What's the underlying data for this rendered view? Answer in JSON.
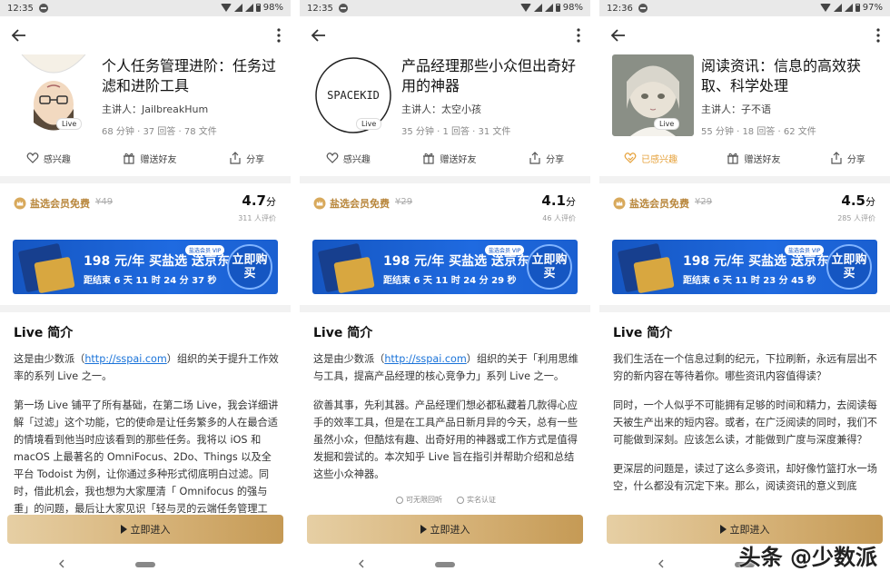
{
  "screens": [
    {
      "status": {
        "time": "12:35",
        "battery": "98%"
      },
      "title": "个人任务管理进阶：任务过滤和进阶工具",
      "speaker": "主讲人：JailbreakHum",
      "meta": "68 分钟 · 37 回答 · 78 文件",
      "live_tag": "Live",
      "actions": {
        "interest": "感兴趣",
        "gift": "赠送好友",
        "share": "分享"
      },
      "vip_label": "盐选会员免费",
      "orig_price": "¥49",
      "rating": "4.7",
      "rating_unit": "分",
      "rating_count": "311 人评价",
      "banner": {
        "main": "198 元/年 买盐选 送京东",
        "sub": "距结束 6 天 11 时 24 分 37 秒",
        "tag": "盐选会员 VIP",
        "buy": "立即购买"
      },
      "intro_title": "Live 简介",
      "intro": [
        {
          "pre": "这是由少数派（",
          "link": "http://sspai.com",
          "post": "）组织的关于提升工作效率的系列 Live 之一。"
        },
        {
          "pre": "第一场 Live 铺平了所有基础，在第二场 Live，我会详细讲解「过滤」这个功能，它的使命是让任务繁多的人在最合适的情境看到他当时应该看到的那些任务。我将以 iOS 和 macOS 上最著名的 OmniFocus、2Do、Things 以及全平台 Todoist 为例，让你通过多种形式彻底明白过滤。同时，借此机会，我也想为大家厘清「 Omnifocus 的强与重」的问题，最后让大家见识「轻与灵的云端任务管理工",
          "link": "",
          "post": ""
        }
      ],
      "badges": [],
      "enter": "立即进入"
    },
    {
      "status": {
        "time": "12:35",
        "battery": "98%"
      },
      "title": "产品经理那些小众但出奇好用的神器",
      "speaker": "主讲人：太空小孩",
      "meta": "35 分钟 · 1 回答 · 31 文件",
      "live_tag": "Live",
      "cover_text": "SPACEKID",
      "actions": {
        "interest": "感兴趣",
        "gift": "赠送好友",
        "share": "分享"
      },
      "vip_label": "盐选会员免费",
      "orig_price": "¥29",
      "rating": "4.1",
      "rating_unit": "分",
      "rating_count": "46 人评价",
      "banner": {
        "main": "198 元/年 买盐选 送京东",
        "sub": "距结束 6 天 11 时 24 分 29 秒",
        "tag": "盐选会员 VIP",
        "buy": "立即购买"
      },
      "intro_title": "Live 简介",
      "intro": [
        {
          "pre": "这是由少数派（",
          "link": "http://sspai.com",
          "post": "）组织的关于「利用思维与工具，提高产品经理的核心竞争力」系列 Live 之一。"
        },
        {
          "pre": "欲善其事，先利其器。产品经理们想必都私藏着几款得心应手的效率工具，但是在工具产品日新月异的今天，总有一些虽然小众，但酷炫有趣、出奇好用的神器或工作方式是值得发掘和尝试的。本次知乎 Live 旨在指引并帮助介绍和总结这些小众神器。",
          "link": "",
          "post": ""
        }
      ],
      "badges": [
        "可无限回听",
        "实名认证"
      ],
      "enter": "立即进入"
    },
    {
      "status": {
        "time": "12:36",
        "battery": "97%"
      },
      "title": "阅读资讯：信息的高效获取、科学处理",
      "speaker": "主讲人：子不语",
      "meta": "55 分钟 · 18 回答 · 62 文件",
      "live_tag": "Live",
      "actions": {
        "interest": "已感兴趣",
        "gift": "赠送好友",
        "share": "分享"
      },
      "vip_label": "盐选会员免费",
      "orig_price": "¥29",
      "rating": "4.5",
      "rating_unit": "分",
      "rating_count": "285 人评价",
      "banner": {
        "main": "198 元/年 买盐选 送京东",
        "sub": "距结束 6 天 11 时 23 分 45 秒",
        "tag": "盐选会员 VIP",
        "buy": "立即购买"
      },
      "intro_title": "Live 简介",
      "intro": [
        {
          "pre": "我们生活在一个信息过剩的纪元，下拉刷新，永远有层出不穷的新内容在等待着你。哪些资讯内容值得读？",
          "link": "",
          "post": ""
        },
        {
          "pre": "同时，一个人似乎不可能拥有足够的时间和精力，去阅读每天被生产出来的短内容。或者，在广泛阅读的同时，我们不可能做到深刻。应该怎么读，才能做到广度与深度兼得？",
          "link": "",
          "post": ""
        },
        {
          "pre": "更深层的问题是，读过了这么多资讯，却好像竹篮打水一场空，什么都没有沉定下来。那么，阅读资讯的意义到底",
          "link": "",
          "post": ""
        }
      ],
      "badges": [],
      "enter": "立即进入"
    }
  ],
  "watermark": "头条 @少数派",
  "colors": {
    "accent_gold": "#b8863b",
    "link": "#1a73d9",
    "banner_blue": "#1556c2",
    "interest_active": "#e6a23c"
  }
}
